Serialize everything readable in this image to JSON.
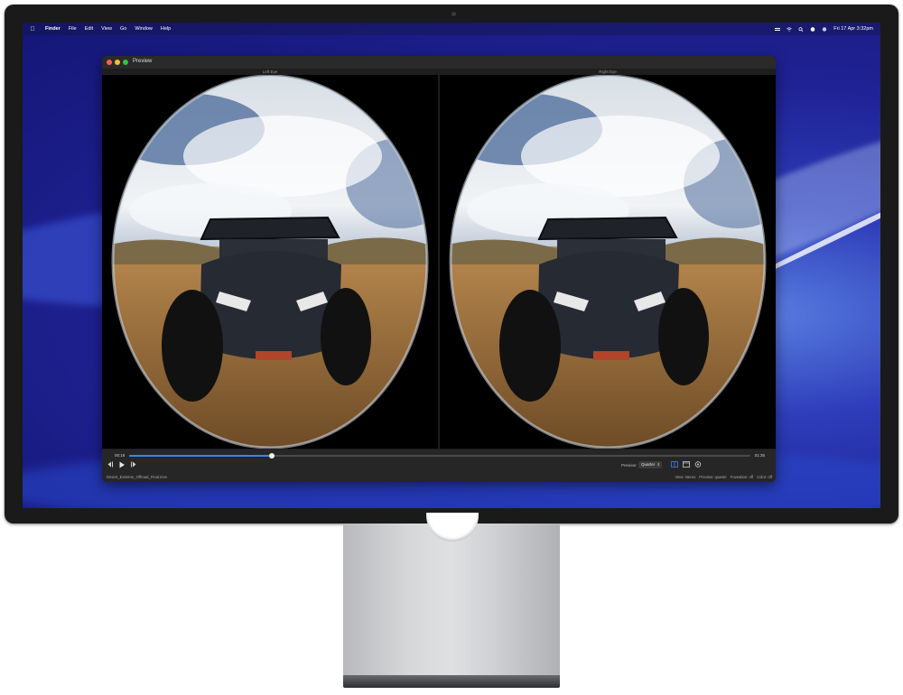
{
  "menubar": {
    "apple_icon": "apple-logo-icon",
    "app_name": "Finder",
    "items": [
      "File",
      "Edit",
      "View",
      "Go",
      "Window",
      "Help"
    ],
    "clock": "Fri 17 Apr  3:32pm"
  },
  "window": {
    "title": "Preview",
    "left_eye_label": "Left Eye",
    "right_eye_label": "Right Eye"
  },
  "player": {
    "current_time": "00:18",
    "total_time": "01:35",
    "progress": 0.23,
    "preview_label": "Preview:",
    "quality_value": "Quarter",
    "filename": "Desert_Extreme_Offroad_Final.mov",
    "status": {
      "view": "View: stereo",
      "preview": "Preview: quarter",
      "foveation": "Foveation: off",
      "color": "Color: off"
    }
  },
  "colors": {
    "accent": "#3a82f6",
    "desktop": "#1f2294"
  }
}
